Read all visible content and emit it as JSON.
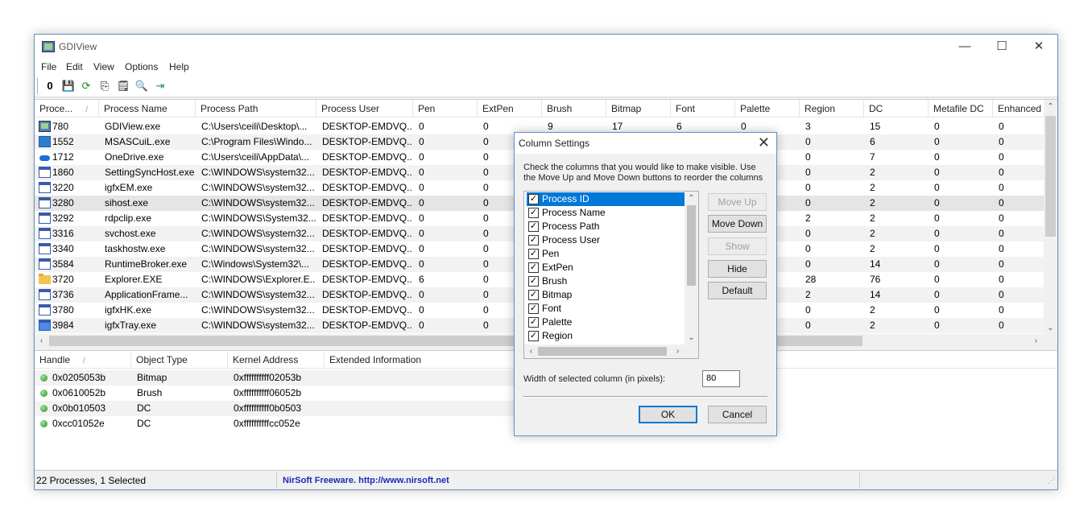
{
  "window": {
    "title": "GDIView",
    "minimize": "—",
    "maximize": "☐",
    "close": "✕"
  },
  "menu": [
    "File",
    "Edit",
    "View",
    "Options",
    "Help"
  ],
  "toolbar": [
    {
      "name": "properties-icon",
      "glyph": "0"
    },
    {
      "name": "save-icon",
      "glyph": "💾"
    },
    {
      "name": "refresh-icon",
      "glyph": "⟳"
    },
    {
      "name": "copy-icon",
      "glyph": "⎘"
    },
    {
      "name": "properties-sheet-icon",
      "glyph": "🗒"
    },
    {
      "name": "find-icon",
      "glyph": "🔍"
    },
    {
      "name": "exit-icon",
      "glyph": "⇥"
    }
  ],
  "process_columns": [
    "Proce...",
    "Process Name",
    "Process Path",
    "Process User",
    "Pen",
    "ExtPen",
    "Brush",
    "Bitmap",
    "Font",
    "Palette",
    "Region",
    "DC",
    "Metafile DC",
    "Enhanced"
  ],
  "process_rows": [
    {
      "icon": "gdi",
      "cells": [
        "780",
        "GDIView.exe",
        "C:\\Users\\ceili\\Desktop\\...",
        "DESKTOP-EMDVQ...",
        "0",
        "0",
        "9",
        "17",
        "6",
        "0",
        "3",
        "15",
        "0",
        "0"
      ]
    },
    {
      "icon": "blue",
      "cells": [
        "1552",
        "MSASCuiL.exe",
        "C:\\Program Files\\Windo...",
        "DESKTOP-EMDVQ...",
        "0",
        "0",
        "",
        "",
        "",
        "",
        "0",
        "6",
        "0",
        "0"
      ]
    },
    {
      "icon": "cloud",
      "cells": [
        "1712",
        "OneDrive.exe",
        "C:\\Users\\ceili\\AppData\\...",
        "DESKTOP-EMDVQ...",
        "0",
        "0",
        "",
        "",
        "",
        "",
        "0",
        "7",
        "0",
        "0"
      ]
    },
    {
      "icon": "win",
      "cells": [
        "1860",
        "SettingSyncHost.exe",
        "C:\\WINDOWS\\system32...",
        "DESKTOP-EMDVQ...",
        "0",
        "0",
        "",
        "",
        "",
        "",
        "0",
        "2",
        "0",
        "0"
      ]
    },
    {
      "icon": "win",
      "cells": [
        "3220",
        "igfxEM.exe",
        "C:\\WINDOWS\\system32...",
        "DESKTOP-EMDVQ...",
        "0",
        "0",
        "",
        "",
        "",
        "",
        "0",
        "2",
        "0",
        "0"
      ]
    },
    {
      "icon": "win",
      "cells": [
        "3280",
        "sihost.exe",
        "C:\\WINDOWS\\system32...",
        "DESKTOP-EMDVQ...",
        "0",
        "0",
        "",
        "",
        "",
        "",
        "0",
        "2",
        "0",
        "0"
      ]
    },
    {
      "icon": "win",
      "cells": [
        "3292",
        "rdpclip.exe",
        "C:\\WINDOWS\\System32...",
        "DESKTOP-EMDVQ...",
        "0",
        "0",
        "",
        "",
        "",
        "",
        "2",
        "2",
        "0",
        "0"
      ]
    },
    {
      "icon": "win",
      "cells": [
        "3316",
        "svchost.exe",
        "C:\\WINDOWS\\system32...",
        "DESKTOP-EMDVQ...",
        "0",
        "0",
        "",
        "",
        "",
        "",
        "0",
        "2",
        "0",
        "0"
      ]
    },
    {
      "icon": "win",
      "cells": [
        "3340",
        "taskhostw.exe",
        "C:\\WINDOWS\\system32...",
        "DESKTOP-EMDVQ...",
        "0",
        "0",
        "",
        "",
        "",
        "",
        "0",
        "2",
        "0",
        "0"
      ]
    },
    {
      "icon": "win",
      "cells": [
        "3584",
        "RuntimeBroker.exe",
        "C:\\Windows\\System32\\...",
        "DESKTOP-EMDVQ...",
        "0",
        "0",
        "",
        "",
        "",
        "",
        "0",
        "14",
        "0",
        "0"
      ]
    },
    {
      "icon": "folder",
      "cells": [
        "3720",
        "Explorer.EXE",
        "C:\\WINDOWS\\Explorer.E...",
        "DESKTOP-EMDVQ...",
        "6",
        "0",
        "",
        "",
        "",
        "",
        "28",
        "76",
        "0",
        "0"
      ]
    },
    {
      "icon": "win",
      "cells": [
        "3736",
        "ApplicationFrame...",
        "C:\\WINDOWS\\system32...",
        "DESKTOP-EMDVQ...",
        "0",
        "0",
        "",
        "",
        "",
        "",
        "2",
        "14",
        "0",
        "0"
      ]
    },
    {
      "icon": "win",
      "cells": [
        "3780",
        "igfxHK.exe",
        "C:\\WINDOWS\\system32...",
        "DESKTOP-EMDVQ...",
        "0",
        "0",
        "",
        "",
        "",
        "",
        "0",
        "2",
        "0",
        "0"
      ]
    },
    {
      "icon": "tray",
      "cells": [
        "3984",
        "igfxTray.exe",
        "C:\\WINDOWS\\system32...",
        "DESKTOP-EMDVQ...",
        "0",
        "0",
        "",
        "",
        "",
        "",
        "0",
        "2",
        "0",
        "0"
      ]
    }
  ],
  "handle_columns": [
    "Handle",
    "Object Type",
    "Kernel Address",
    "Extended Information"
  ],
  "handle_rows": [
    [
      "0x0205053b",
      "Bitmap",
      "0xffffffffff02053b",
      ""
    ],
    [
      "0x0610052b",
      "Brush",
      "0xffffffffff06052b",
      ""
    ],
    [
      "0x0b010503",
      "DC",
      "0xffffffffff0b0503",
      ""
    ],
    [
      "0xcc01052e",
      "DC",
      "0xffffffffffcc052e",
      ""
    ]
  ],
  "status": {
    "processes": "22 Processes, 1 Selected",
    "link": "NirSoft Freeware.  http://www.nirsoft.net"
  },
  "dialog": {
    "title": "Column Settings",
    "instructions": "Check the columns that you would like to make visible. Use the Move Up and Move Down buttons to reorder the columns",
    "columns": [
      {
        "label": "Process ID",
        "checked": true,
        "selected": true
      },
      {
        "label": "Process Name",
        "checked": true
      },
      {
        "label": "Process Path",
        "checked": true
      },
      {
        "label": "Process User",
        "checked": true
      },
      {
        "label": "Pen",
        "checked": true
      },
      {
        "label": "ExtPen",
        "checked": true
      },
      {
        "label": "Brush",
        "checked": true
      },
      {
        "label": "Bitmap",
        "checked": true
      },
      {
        "label": "Font",
        "checked": true
      },
      {
        "label": "Palette",
        "checked": true
      },
      {
        "label": "Region",
        "checked": true
      }
    ],
    "buttons": {
      "move_up": "Move Up",
      "move_down": "Move Down",
      "show": "Show",
      "hide": "Hide",
      "default": "Default",
      "ok": "OK",
      "cancel": "Cancel"
    },
    "width_label": "Width of selected column (in pixels):",
    "width_value": "80"
  },
  "colors": {
    "accent": "#0078d7",
    "link": "#1a2bb8",
    "selection": "#e5e5e5"
  }
}
